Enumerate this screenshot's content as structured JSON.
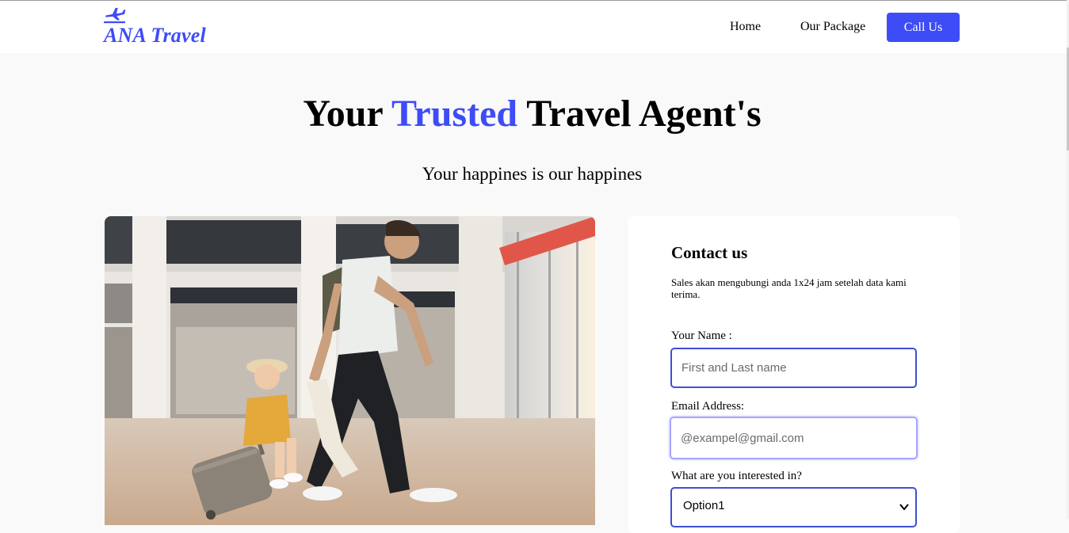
{
  "brand": {
    "name": "ANA Travel",
    "accent_color": "#3d4cf6",
    "logo_icon": "airplane-icon"
  },
  "nav": {
    "home": "Home",
    "package": "Our Package",
    "call": "Call Us"
  },
  "hero": {
    "title_before": "Your ",
    "title_accent": "Trusted",
    "title_after": " Travel Agent's",
    "subtitle": "Your happines is our happines"
  },
  "contact": {
    "title": "Contact us",
    "description": "Sales akan mengubungi anda 1x24 jam setelah data kami terima.",
    "name_label": "Your Name :",
    "name_placeholder": "First and Last name",
    "email_label": "Email Address:",
    "email_placeholder": "@exampel@gmail.com",
    "interest_label": "What are you interested in?",
    "interest_selected": "Option1"
  },
  "hero_photo": {
    "icon": "family-travel-photo"
  }
}
